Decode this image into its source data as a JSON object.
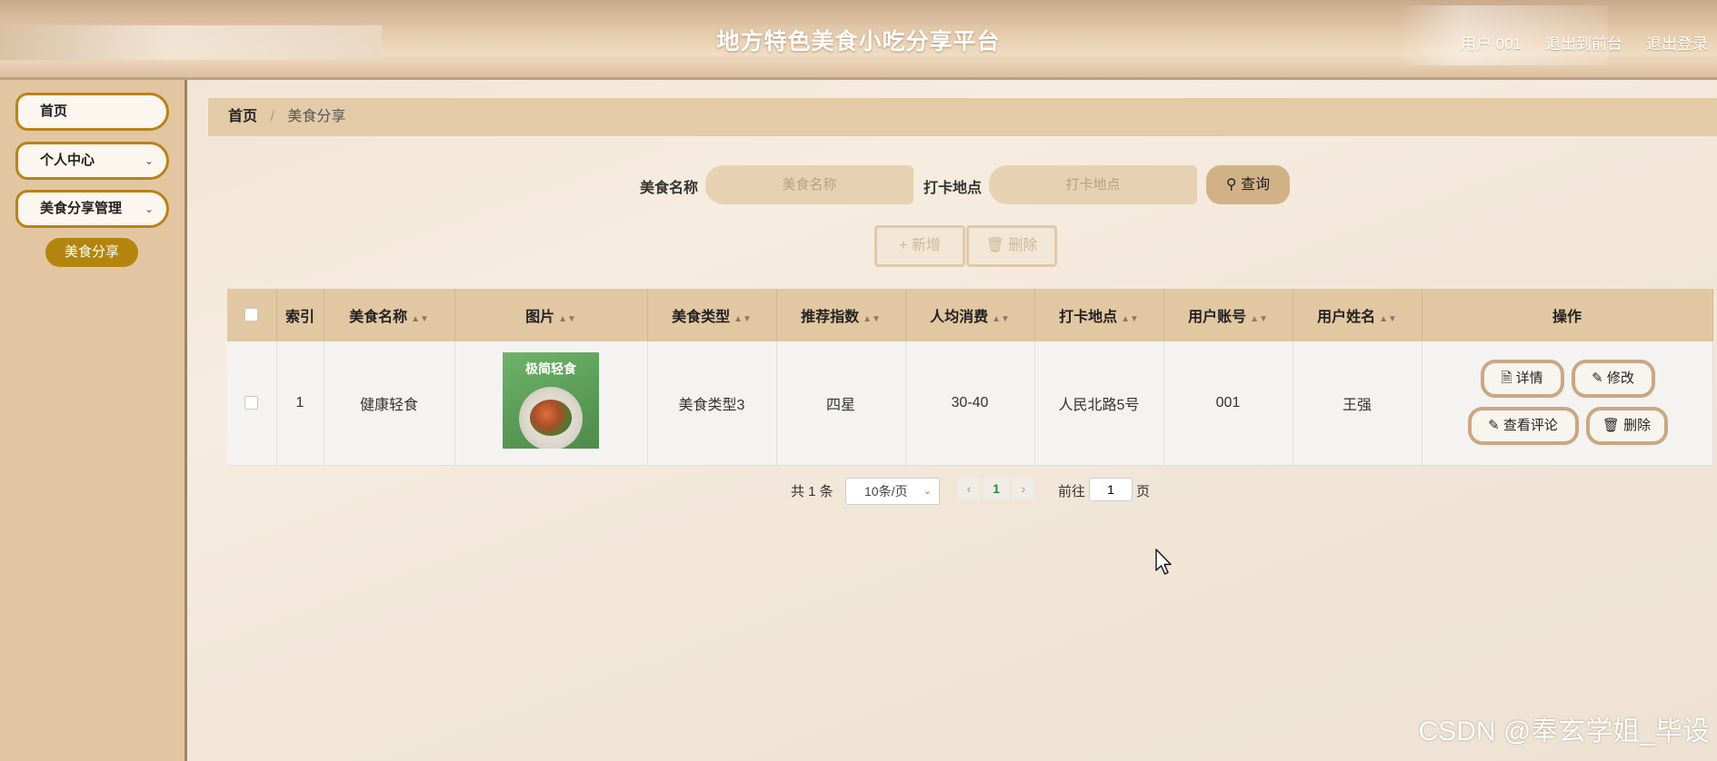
{
  "header": {
    "title": "地方特色美食小吃分享平台",
    "user": "用户 001",
    "back_front": "退出到前台",
    "logout": "退出登录"
  },
  "sidebar": {
    "items": [
      {
        "label": "首页"
      },
      {
        "label": "个人中心"
      },
      {
        "label": "美食分享管理"
      }
    ],
    "sub_item": "美食分享"
  },
  "breadcrumb": {
    "home": "首页",
    "sep": "/",
    "current": "美食分享"
  },
  "search": {
    "food_name_label": "美食名称",
    "food_name_placeholder": "美食名称",
    "checkin_label": "打卡地点",
    "checkin_placeholder": "打卡地点",
    "query_label": "查询"
  },
  "actions": {
    "add_label": "新增",
    "delete_label": "删除"
  },
  "table": {
    "columns": [
      "索引",
      "美食名称",
      "图片",
      "美食类型",
      "推荐指数",
      "人均消费",
      "打卡地点",
      "用户账号",
      "用户姓名",
      "操作"
    ],
    "rows": [
      {
        "index": "1",
        "name": "健康轻食",
        "image_text": "极简轻食",
        "type": "美食类型3",
        "rating": "四星",
        "avg_cost": "30-40",
        "location": "人民北路5号",
        "account": "001",
        "username": "王强"
      }
    ],
    "op_buttons": {
      "detail": "详情",
      "edit": "修改",
      "comments": "查看评论",
      "delete": "删除"
    }
  },
  "pagination": {
    "total": "共 1 条",
    "page_size": "10条/页",
    "current_page": "1",
    "goto_label": "前往",
    "goto_value": "1",
    "page_label": "页"
  },
  "watermark": "CSDN @奉玄学姐_毕设",
  "colors": {
    "accent": "#b4850e",
    "header_bg": "#e4c9ab",
    "sidebar_bg": "#e2c6a2"
  }
}
